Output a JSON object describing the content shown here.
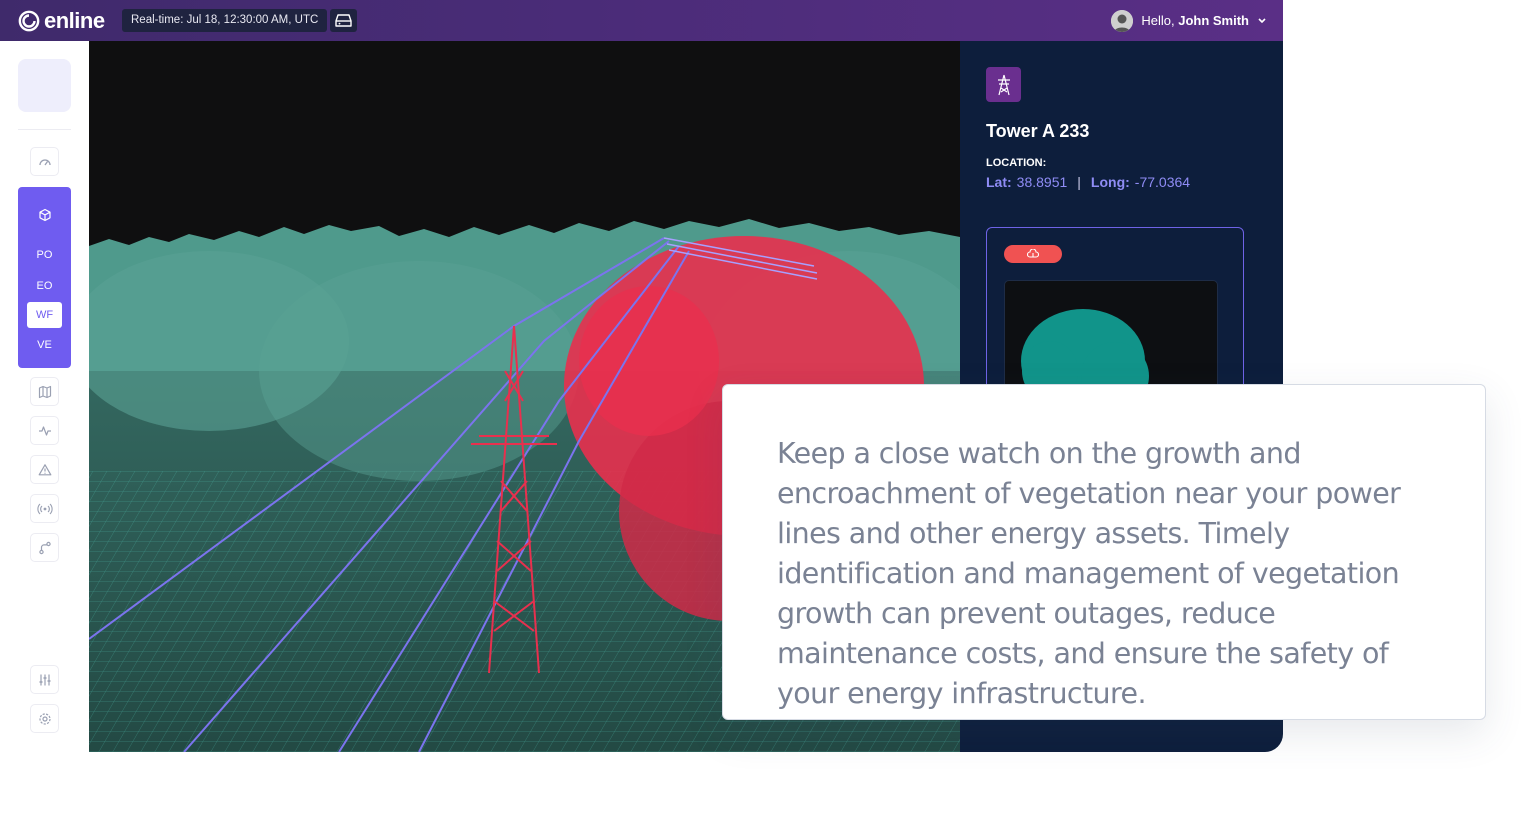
{
  "brand": {
    "name": "enline"
  },
  "topbar": {
    "realtime": "Real-time: Jul 18, 12:30:00 AM, UTC",
    "drive_icon": "drive-icon",
    "greeting": "Hello,",
    "user_name": "John Smith",
    "user_menu_icon": "chevron-down-icon"
  },
  "sidebar": {
    "icons_top": [
      "dashboard-gauge-icon"
    ],
    "group": {
      "icon": "cube-icon",
      "items": [
        {
          "label": "PO",
          "active": false
        },
        {
          "label": "EO",
          "active": false
        },
        {
          "label": "WF",
          "active": true
        },
        {
          "label": "VE",
          "active": false
        }
      ]
    },
    "icons_mid": [
      "map-icon",
      "activity-icon",
      "alert-triangle-icon",
      "broadcast-icon",
      "route-icon"
    ],
    "icons_bottom": [
      "sliders-icon",
      "settings-icon"
    ]
  },
  "panel": {
    "title": "Tower A 233",
    "location_label": "LOCATION:",
    "lat_label": "Lat:",
    "lat_value": "38.8951",
    "long_label": "Long:",
    "long_value": "-77.0364",
    "alert_icon": "cloud-alert-icon"
  },
  "overlay": {
    "text": "Keep a close watch on the growth and encroachment of vegetation near your power lines and other energy assets. Timely identification and management of vegetation growth can prevent outages, reduce maintenance costs, and ensure the safety of your energy infrastructure."
  },
  "colors": {
    "accent": "#6f5cf0",
    "topbar": "#4a2c78",
    "panel": "#0d1e3c",
    "vegetation": "#4f9a8c",
    "encroachment": "#e8304e"
  }
}
